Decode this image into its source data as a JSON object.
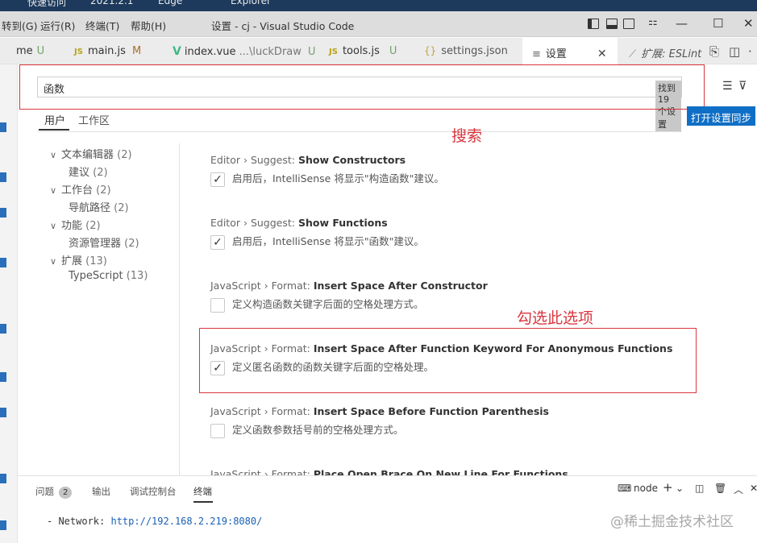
{
  "os_strip": [
    "快速访问",
    "2021.2.1",
    "Edge",
    "Explorer"
  ],
  "menu": [
    "转到(G)",
    "运行(R)",
    "终端(T)",
    "帮助(H)"
  ],
  "window_title": "设置 - cj - Visual Studio Code",
  "window_controls": {
    "minimize": "—",
    "maximize": "☐",
    "close": "✕"
  },
  "tabs": [
    {
      "label": "me",
      "status": "U"
    },
    {
      "icon": "JS",
      "label": "main.js",
      "status": "M"
    },
    {
      "icon": "V",
      "label": "index.vue",
      "path": "...\\luckDraw",
      "status": "U"
    },
    {
      "icon": "JS",
      "label": "tools.js",
      "status": "U"
    },
    {
      "icon": "{}",
      "label": "settings.json"
    },
    {
      "label": "设置",
      "close": "✕"
    },
    {
      "label": "扩展: ESLint"
    }
  ],
  "search": {
    "value": "函数",
    "found": "找到 19 个设置"
  },
  "sync_button": "打开设置同步",
  "scope_tabs": [
    "用户",
    "工作区"
  ],
  "annotations": {
    "search": "搜索",
    "check": "勾选此选项"
  },
  "toc": [
    {
      "label": "文本编辑器",
      "count": "(2)",
      "expanded": true
    },
    {
      "label": "建议",
      "count": "(2)",
      "child": true
    },
    {
      "label": "工作台",
      "count": "(2)",
      "expanded": true
    },
    {
      "label": "导航路径",
      "count": "(2)",
      "child": true
    },
    {
      "label": "功能",
      "count": "(2)",
      "expanded": true
    },
    {
      "label": "资源管理器",
      "count": "(2)",
      "child": true
    },
    {
      "label": "扩展",
      "count": "(13)",
      "expanded": true
    },
    {
      "label": "TypeScript",
      "count": "(13)",
      "child": true
    }
  ],
  "settings": [
    {
      "prefix": "Editor › Suggest: ",
      "name": "Show Constructors",
      "desc": "启用后，IntelliSense 将显示\"构造函数\"建议。",
      "checked": true
    },
    {
      "prefix": "Editor › Suggest: ",
      "name": "Show Functions",
      "desc": "启用后，IntelliSense 将显示\"函数\"建议。",
      "checked": true
    },
    {
      "prefix": "JavaScript › Format: ",
      "name": "Insert Space After Constructor",
      "desc": "定义构造函数关键字后面的空格处理方式。",
      "checked": false
    },
    {
      "prefix": "JavaScript › Format: ",
      "name": "Insert Space After Function Keyword For Anonymous Functions",
      "desc": "定义匿名函数的函数关键字后面的空格处理。",
      "checked": true
    },
    {
      "prefix": "JavaScript › Format: ",
      "name": "Insert Space Before Function Parenthesis",
      "desc": "定义函数参数括号前的空格处理方式。",
      "checked": false
    },
    {
      "prefix": "JavaScript › Format: ",
      "name": "Place Open Brace On New Line For Functions",
      "desc": "",
      "checked": false
    }
  ],
  "panel": {
    "tabs": [
      "问题",
      "输出",
      "调试控制台",
      "终端"
    ],
    "problems_count": "2",
    "terminal_name": "node",
    "terminal_line": {
      "label": "- Network: ",
      "url": "http://192.168.2.219:8080/"
    }
  },
  "watermark": "@稀土掘金技术社区",
  "colors": {
    "accent": "#0f6fc6",
    "annotation": "#d9363e"
  }
}
